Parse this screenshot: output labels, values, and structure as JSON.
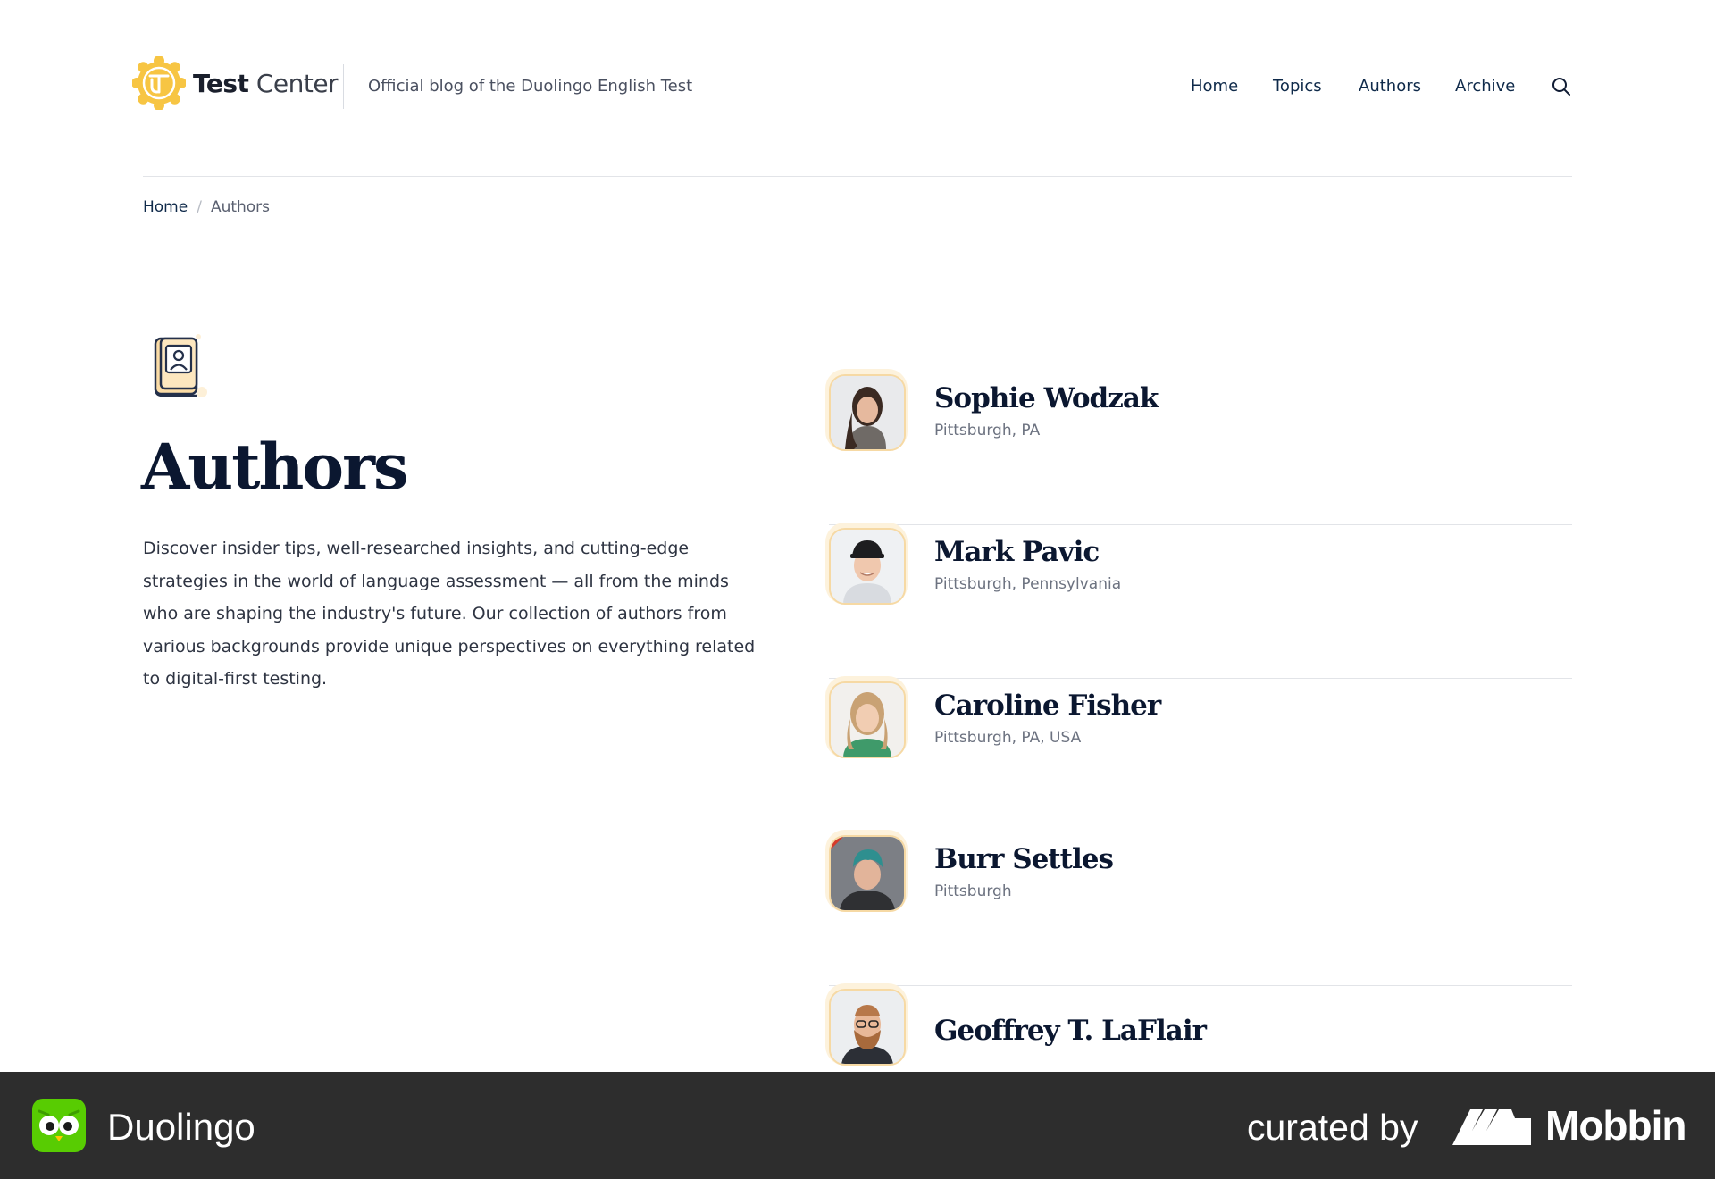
{
  "header": {
    "brand_bold": "Test",
    "brand_light": "Center",
    "tagline": "Official blog of the Duolingo English Test",
    "nav": {
      "home": "Home",
      "topics": "Topics",
      "authors": "Authors",
      "archive": "Archive"
    },
    "search_icon": "search-icon",
    "logo_icon": "test-center-logo-icon"
  },
  "breadcrumb": {
    "home": "Home",
    "separator": "/",
    "current": "Authors"
  },
  "hero": {
    "icon": "author-book-icon",
    "title": "Authors",
    "intro": "Discover insider tips, well-researched insights, and cutting-edge strategies in the world of language assessment — all from the minds who are shaping the industry's future. Our collection of authors from various backgrounds provide unique perspectives on everything related to digital-first testing."
  },
  "authors": [
    {
      "name": "Sophie Wodzak",
      "location": "Pittsburgh, PA"
    },
    {
      "name": "Mark Pavic",
      "location": "Pittsburgh, Pennsylvania"
    },
    {
      "name": "Caroline Fisher",
      "location": "Pittsburgh, PA, USA"
    },
    {
      "name": "Burr Settles",
      "location": "Pittsburgh"
    },
    {
      "name": "Geoffrey T. LaFlair",
      "location": ""
    }
  ],
  "footer": {
    "app_name": "Duolingo",
    "curated_by": "curated by",
    "curator": "Mobbin"
  },
  "colors": {
    "accent_yellow": "#f7c543",
    "text_dark": "#0b1730",
    "footer_bg": "#2d2d2d",
    "duolingo_green": "#58cc02"
  }
}
